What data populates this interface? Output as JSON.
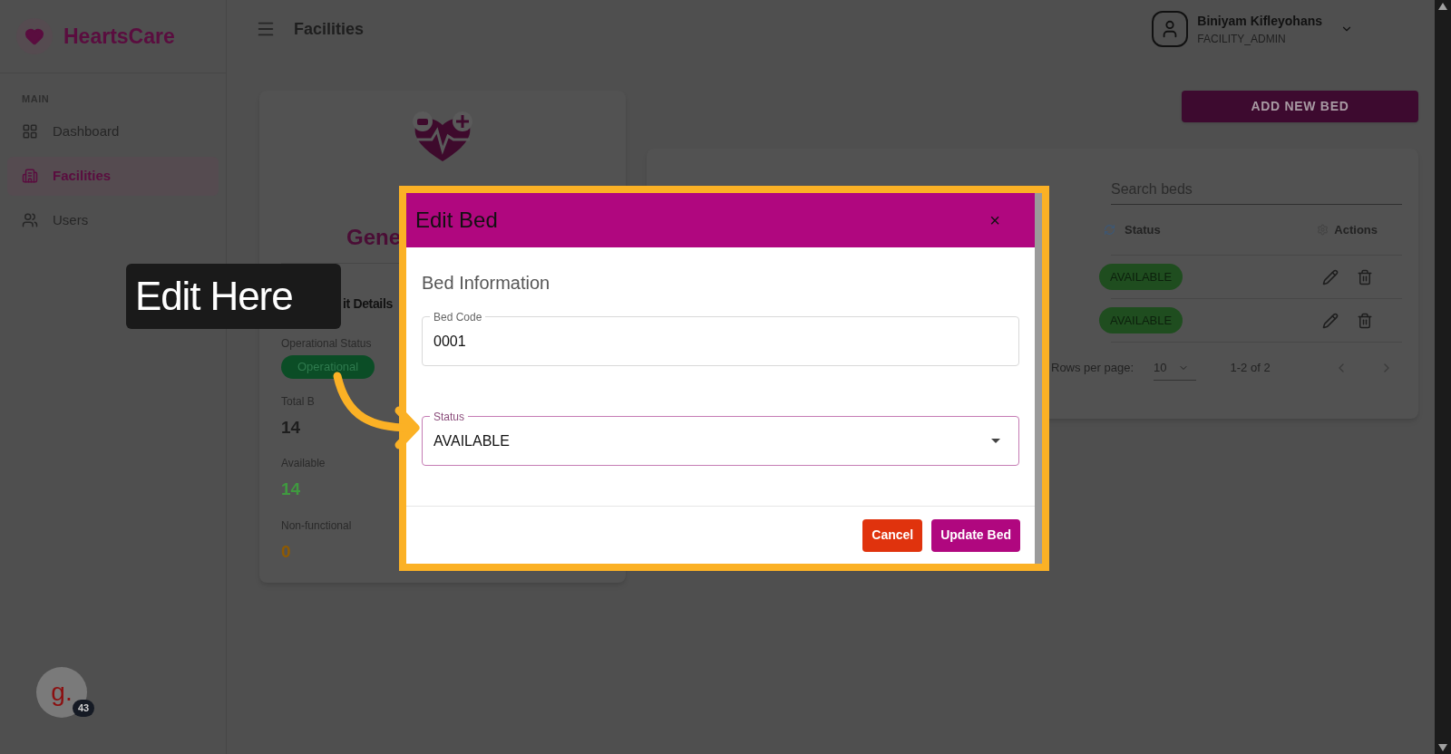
{
  "sidebar": {
    "brand": "HeartsCare",
    "section": "MAIN",
    "items": [
      {
        "label": "Dashboard",
        "selected": false
      },
      {
        "label": "Facilities",
        "selected": true
      },
      {
        "label": "Users",
        "selected": false
      }
    ]
  },
  "header": {
    "title": "Facilities",
    "user": {
      "name": "Biniyam Kifleyohans",
      "role": "FACILITY_ADMIN"
    }
  },
  "facility_card": {
    "heading": "Gene",
    "section_title": "it Details",
    "operational_status": {
      "label": "Operational Status",
      "value": "Operational"
    },
    "stats": [
      {
        "label": "Total B",
        "value": "14",
        "kind": "total"
      },
      {
        "label": "Available",
        "value": "14",
        "kind": "available"
      },
      {
        "label": "Non-functional",
        "value": "0",
        "kind": "nonfunctional"
      }
    ]
  },
  "add_button": "ADD NEW BED",
  "beds_table": {
    "search": {
      "placeholder": "Search beds"
    },
    "columns": [
      "Status",
      "Actions"
    ],
    "rows": [
      {
        "status": "AVAILABLE"
      },
      {
        "status": "AVAILABLE"
      }
    ],
    "pagination": {
      "rows_per_page_label": "Rows per page:",
      "rows_per_page": "10",
      "range": "1-2 of 2"
    }
  },
  "dialog": {
    "title": "Edit Bed",
    "close": "×",
    "section": "Bed Information",
    "fields": [
      {
        "label": "Bed Code",
        "value": "0001",
        "kind": "text",
        "focused": false
      },
      {
        "label": "Status",
        "value": "AVAILABLE",
        "kind": "select",
        "focused": true
      }
    ],
    "buttons": [
      {
        "label": "Cancel",
        "kind": "cancel"
      },
      {
        "label": "Update Bed",
        "kind": "primary"
      }
    ]
  },
  "callout": {
    "text": "Edit Here"
  },
  "widget": {
    "letter": "g.",
    "badge": "43"
  }
}
